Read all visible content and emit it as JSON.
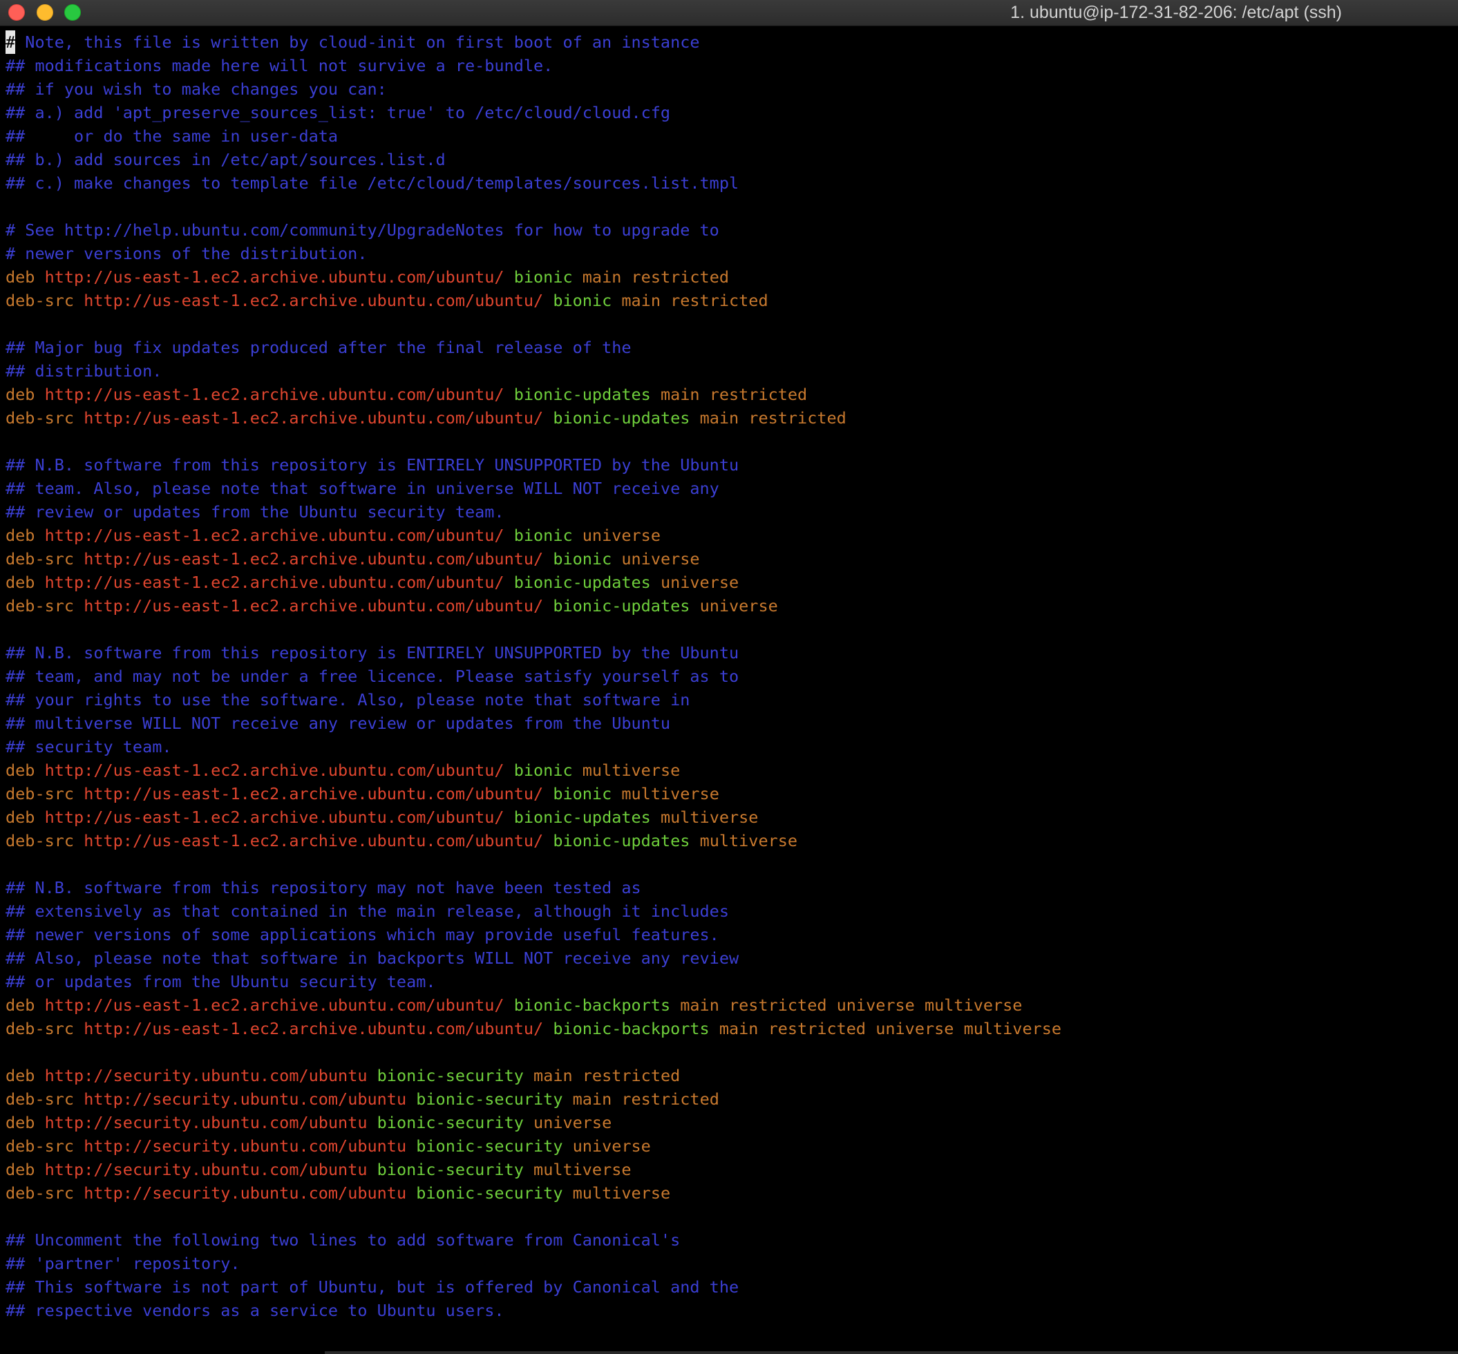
{
  "window": {
    "title": "1. ubuntu@ip-172-31-82-206: /etc/apt (ssh)"
  },
  "colors": {
    "background": "#000000",
    "comment": "#3b3fd4",
    "keyword": "#c8792e",
    "url": "#e0462f",
    "distribution": "#6fcf3c",
    "component": "#c8792e"
  },
  "cursor_char": "#",
  "lines": [
    {
      "type": "comment",
      "text": "# Note, this file is written by cloud-init on first boot of an instance",
      "cursor": true
    },
    {
      "type": "comment",
      "text": "## modifications made here will not survive a re-bundle."
    },
    {
      "type": "comment",
      "text": "## if you wish to make changes you can:"
    },
    {
      "type": "comment",
      "text": "## a.) add 'apt_preserve_sources_list: true' to /etc/cloud/cloud.cfg"
    },
    {
      "type": "comment",
      "text": "##     or do the same in user-data"
    },
    {
      "type": "comment",
      "text": "## b.) add sources in /etc/apt/sources.list.d"
    },
    {
      "type": "comment",
      "text": "## c.) make changes to template file /etc/cloud/templates/sources.list.tmpl"
    },
    {
      "type": "blank",
      "text": ""
    },
    {
      "type": "comment",
      "text": "# See http://help.ubuntu.com/community/UpgradeNotes for how to upgrade to"
    },
    {
      "type": "comment",
      "text": "# newer versions of the distribution."
    },
    {
      "type": "source",
      "kw": "deb",
      "url": "http://us-east-1.ec2.archive.ubuntu.com/ubuntu/",
      "dist": "bionic",
      "comps": "main restricted"
    },
    {
      "type": "source",
      "kw": "deb-src",
      "url": "http://us-east-1.ec2.archive.ubuntu.com/ubuntu/",
      "dist": "bionic",
      "comps": "main restricted"
    },
    {
      "type": "blank",
      "text": ""
    },
    {
      "type": "comment",
      "text": "## Major bug fix updates produced after the final release of the"
    },
    {
      "type": "comment",
      "text": "## distribution."
    },
    {
      "type": "source",
      "kw": "deb",
      "url": "http://us-east-1.ec2.archive.ubuntu.com/ubuntu/",
      "dist": "bionic-updates",
      "comps": "main restricted"
    },
    {
      "type": "source",
      "kw": "deb-src",
      "url": "http://us-east-1.ec2.archive.ubuntu.com/ubuntu/",
      "dist": "bionic-updates",
      "comps": "main restricted"
    },
    {
      "type": "blank",
      "text": ""
    },
    {
      "type": "comment",
      "text": "## N.B. software from this repository is ENTIRELY UNSUPPORTED by the Ubuntu"
    },
    {
      "type": "comment",
      "text": "## team. Also, please note that software in universe WILL NOT receive any"
    },
    {
      "type": "comment",
      "text": "## review or updates from the Ubuntu security team."
    },
    {
      "type": "source",
      "kw": "deb",
      "url": "http://us-east-1.ec2.archive.ubuntu.com/ubuntu/",
      "dist": "bionic",
      "comps": "universe"
    },
    {
      "type": "source",
      "kw": "deb-src",
      "url": "http://us-east-1.ec2.archive.ubuntu.com/ubuntu/",
      "dist": "bionic",
      "comps": "universe"
    },
    {
      "type": "source",
      "kw": "deb",
      "url": "http://us-east-1.ec2.archive.ubuntu.com/ubuntu/",
      "dist": "bionic-updates",
      "comps": "universe"
    },
    {
      "type": "source",
      "kw": "deb-src",
      "url": "http://us-east-1.ec2.archive.ubuntu.com/ubuntu/",
      "dist": "bionic-updates",
      "comps": "universe"
    },
    {
      "type": "blank",
      "text": ""
    },
    {
      "type": "comment",
      "text": "## N.B. software from this repository is ENTIRELY UNSUPPORTED by the Ubuntu"
    },
    {
      "type": "comment",
      "text": "## team, and may not be under a free licence. Please satisfy yourself as to"
    },
    {
      "type": "comment",
      "text": "## your rights to use the software. Also, please note that software in"
    },
    {
      "type": "comment",
      "text": "## multiverse WILL NOT receive any review or updates from the Ubuntu"
    },
    {
      "type": "comment",
      "text": "## security team."
    },
    {
      "type": "source",
      "kw": "deb",
      "url": "http://us-east-1.ec2.archive.ubuntu.com/ubuntu/",
      "dist": "bionic",
      "comps": "multiverse"
    },
    {
      "type": "source",
      "kw": "deb-src",
      "url": "http://us-east-1.ec2.archive.ubuntu.com/ubuntu/",
      "dist": "bionic",
      "comps": "multiverse"
    },
    {
      "type": "source",
      "kw": "deb",
      "url": "http://us-east-1.ec2.archive.ubuntu.com/ubuntu/",
      "dist": "bionic-updates",
      "comps": "multiverse"
    },
    {
      "type": "source",
      "kw": "deb-src",
      "url": "http://us-east-1.ec2.archive.ubuntu.com/ubuntu/",
      "dist": "bionic-updates",
      "comps": "multiverse"
    },
    {
      "type": "blank",
      "text": ""
    },
    {
      "type": "comment",
      "text": "## N.B. software from this repository may not have been tested as"
    },
    {
      "type": "comment",
      "text": "## extensively as that contained in the main release, although it includes"
    },
    {
      "type": "comment",
      "text": "## newer versions of some applications which may provide useful features."
    },
    {
      "type": "comment",
      "text": "## Also, please note that software in backports WILL NOT receive any review"
    },
    {
      "type": "comment",
      "text": "## or updates from the Ubuntu security team."
    },
    {
      "type": "source",
      "kw": "deb",
      "url": "http://us-east-1.ec2.archive.ubuntu.com/ubuntu/",
      "dist": "bionic-backports",
      "comps": "main restricted universe multiverse"
    },
    {
      "type": "source",
      "kw": "deb-src",
      "url": "http://us-east-1.ec2.archive.ubuntu.com/ubuntu/",
      "dist": "bionic-backports",
      "comps": "main restricted universe multiverse"
    },
    {
      "type": "blank",
      "text": ""
    },
    {
      "type": "source",
      "kw": "deb",
      "url": "http://security.ubuntu.com/ubuntu",
      "dist": "bionic-security",
      "comps": "main restricted"
    },
    {
      "type": "source",
      "kw": "deb-src",
      "url": "http://security.ubuntu.com/ubuntu",
      "dist": "bionic-security",
      "comps": "main restricted"
    },
    {
      "type": "source",
      "kw": "deb",
      "url": "http://security.ubuntu.com/ubuntu",
      "dist": "bionic-security",
      "comps": "universe"
    },
    {
      "type": "source",
      "kw": "deb-src",
      "url": "http://security.ubuntu.com/ubuntu",
      "dist": "bionic-security",
      "comps": "universe"
    },
    {
      "type": "source",
      "kw": "deb",
      "url": "http://security.ubuntu.com/ubuntu",
      "dist": "bionic-security",
      "comps": "multiverse"
    },
    {
      "type": "source",
      "kw": "deb-src",
      "url": "http://security.ubuntu.com/ubuntu",
      "dist": "bionic-security",
      "comps": "multiverse"
    },
    {
      "type": "blank",
      "text": ""
    },
    {
      "type": "comment",
      "text": "## Uncomment the following two lines to add software from Canonical's"
    },
    {
      "type": "comment",
      "text": "## 'partner' repository."
    },
    {
      "type": "comment",
      "text": "## This software is not part of Ubuntu, but is offered by Canonical and the"
    },
    {
      "type": "comment",
      "text": "## respective vendors as a service to Ubuntu users."
    }
  ]
}
